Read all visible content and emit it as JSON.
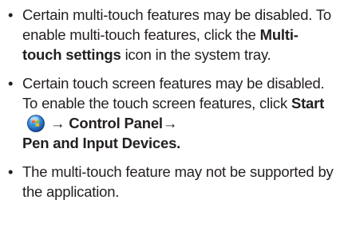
{
  "bullets": [
    {
      "before": "Certain multi-touch features may be disabled. To enable multi-touch features, click the ",
      "bold": "Multi-touch settings",
      "after": " icon in the system tray."
    },
    {
      "text": "Certain touch screen features may be disabled. To enable the touch screen features, click ",
      "start_label": "Start",
      "arrow1": " → ",
      "control_panel": "Control Panel→",
      "pen_input": "Pen and Input Devices."
    },
    {
      "text": "The multi-touch feature may not be supported by the application."
    }
  ],
  "bullet_glyph": "•",
  "icons": {
    "start": "windows-start-orb-icon"
  },
  "colors": {
    "text": "#231f20",
    "orb_blue": "#2a7fd6"
  }
}
